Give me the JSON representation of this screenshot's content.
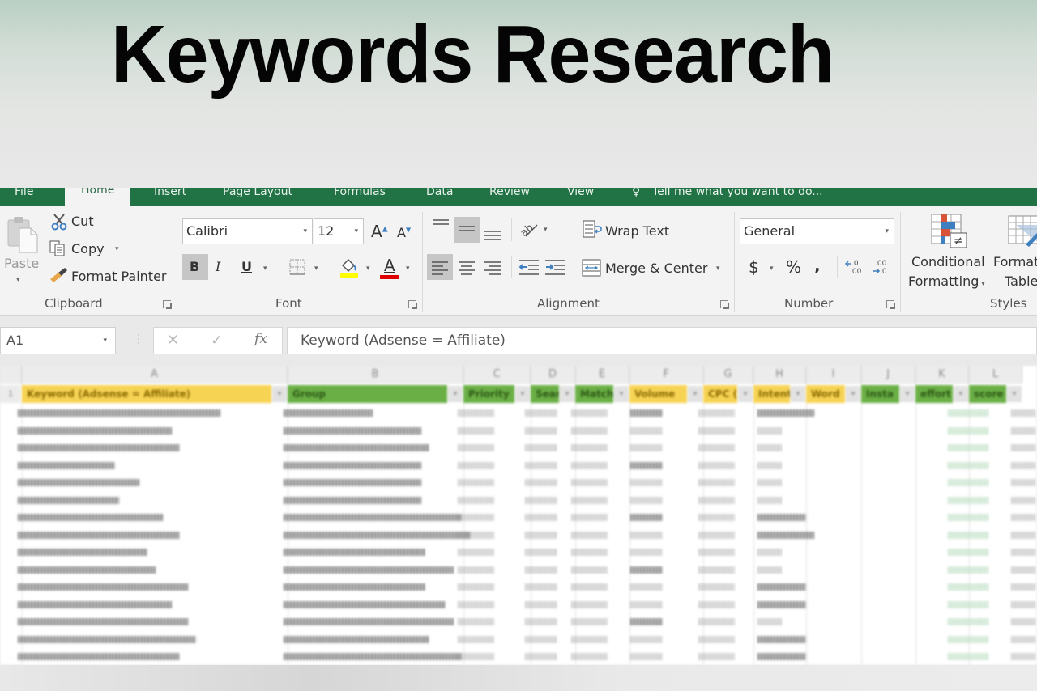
{
  "banner": {
    "title": "Keywords Research"
  },
  "ribbon": {
    "tabs": [
      {
        "label": "File"
      },
      {
        "label": "Home",
        "active": true
      },
      {
        "label": "Insert"
      },
      {
        "label": "Page Layout"
      },
      {
        "label": "Formulas"
      },
      {
        "label": "Data"
      },
      {
        "label": "Review"
      },
      {
        "label": "View"
      }
    ],
    "tell_me": "Tell me what you want to do...",
    "clipboard": {
      "label": "Clipboard",
      "paste": "Paste",
      "cut": "Cut",
      "copy": "Copy",
      "format_painter": "Format Painter"
    },
    "font": {
      "label": "Font",
      "font_name": "Calibri",
      "font_size": "12",
      "bold": "B",
      "italic": "I",
      "underline": "U",
      "grow": "A",
      "shrink": "A",
      "font_color": "A",
      "fill_color_hex": "#ffff00",
      "font_color_hex": "#e00000"
    },
    "alignment": {
      "label": "Alignment",
      "wrap_text": "Wrap Text",
      "merge_center": "Merge & Center"
    },
    "number": {
      "label": "Number",
      "format": "General",
      "currency": "$",
      "percent": "%",
      "comma": ",",
      "inc_decimal": "←.0 .00",
      "dec_decimal": ".00 →.0"
    },
    "styles": {
      "label": "Styles",
      "conditional_1": "Conditional",
      "conditional_2": "Formatting",
      "format_table_1": "Format",
      "format_table_2": "Table"
    }
  },
  "formula_bar": {
    "name_box": "A1",
    "cancel": "✕",
    "enter": "✓",
    "fx": "fx",
    "content": "Keyword (Adsense = Affiliate)"
  },
  "sheet": {
    "columns": [
      "A",
      "B",
      "C",
      "D",
      "E",
      "F",
      "G",
      "H",
      "I",
      "J",
      "K",
      "L"
    ],
    "row1_number": "1",
    "headers": [
      {
        "col": "A",
        "text": "Keyword (Adsense = Affiliate)",
        "color": "#f7d354"
      },
      {
        "col": "B",
        "text": "Group",
        "color": "#6aaf45"
      },
      {
        "col": "C",
        "text": "Priority",
        "color": "#6aaf45"
      },
      {
        "col": "D",
        "text": "Searc",
        "color": "#6aaf45"
      },
      {
        "col": "E",
        "text": "Match",
        "color": "#6aaf45"
      },
      {
        "col": "F",
        "text": "Volume",
        "color": "#f7d354"
      },
      {
        "col": "G",
        "text": "CPC (",
        "color": "#f7d354"
      },
      {
        "col": "H",
        "text": "Intent",
        "color": "#f7d354"
      },
      {
        "col": "I",
        "text": "Word",
        "color": "#f7d354"
      },
      {
        "col": "J",
        "text": "Insta",
        "color": "#6aaf45"
      },
      {
        "col": "K",
        "text": "effort",
        "color": "#6aaf45"
      },
      {
        "col": "L",
        "text": "score",
        "color": "#6aaf45"
      }
    ],
    "data_note": "Data rows are blurred and unreadable"
  },
  "colors": {
    "excel_green": "#217346",
    "ribbon_bg": "#f3f3f3"
  }
}
